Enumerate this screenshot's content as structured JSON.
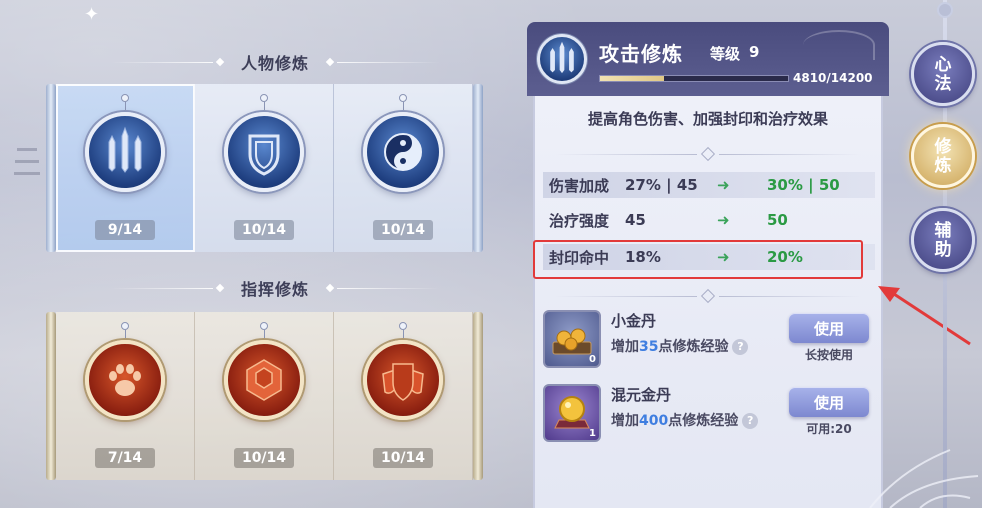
{
  "character_section": {
    "title": "人物修炼",
    "skills": [
      {
        "name": "attack-cultivation",
        "icon": "swords-icon",
        "count": "9/14",
        "selected": true
      },
      {
        "name": "defense-cultivation",
        "icon": "shield-icon",
        "count": "10/14",
        "selected": false
      },
      {
        "name": "magic-cultivation",
        "icon": "yin-yang-icon",
        "count": "10/14",
        "selected": false
      }
    ]
  },
  "command_section": {
    "title": "指挥修炼",
    "skills": [
      {
        "name": "command-paw",
        "icon": "paw-icon",
        "count": "7/14"
      },
      {
        "name": "command-hex",
        "icon": "hexagon-icon",
        "count": "10/14"
      },
      {
        "name": "command-shield",
        "icon": "triple-shield-icon",
        "count": "10/14"
      }
    ]
  },
  "detail": {
    "title": "攻击修炼",
    "level_label": "等级",
    "level": "9",
    "xp_text": "4810/14200",
    "xp_progress": 0.339,
    "description": "提高角色伤害、加强封印和治疗效果",
    "stats": [
      {
        "name": "伤害加成",
        "current": "27% | 45",
        "next": "30% | 50"
      },
      {
        "name": "治疗强度",
        "current": "45",
        "next": "50"
      },
      {
        "name": "封印命中",
        "current": "18%",
        "next": "20%"
      }
    ],
    "items": [
      {
        "name": "小金丹",
        "desc_prefix": "增加",
        "amount": "35",
        "desc_suffix": "点修炼经验",
        "qty": "0",
        "button": "使用",
        "hint": "长按使用"
      },
      {
        "name": "混元金丹",
        "desc_prefix": "增加",
        "amount": "400",
        "desc_suffix": "点修炼经验",
        "qty": "1",
        "button": "使用",
        "hint": "可用:20"
      }
    ]
  },
  "side_tabs": [
    {
      "label": "心法",
      "active": false
    },
    {
      "label": "修炼",
      "active": true
    },
    {
      "label": "辅助",
      "active": false
    }
  ],
  "colors": {
    "highlight_box": "#e23a3a",
    "stat_next": "#2b9a44",
    "amount_blue": "#3f7ee0",
    "panel_header": "#4a4c7e"
  }
}
